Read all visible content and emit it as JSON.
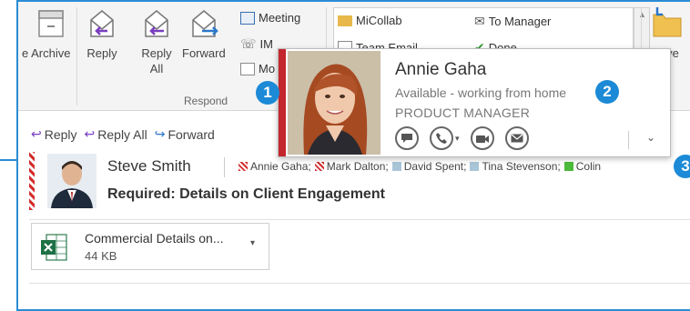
{
  "ribbon": {
    "archive_label": "e Archive",
    "reply_label": "Reply",
    "reply_all_label": "Reply All",
    "forward_label": "Forward",
    "meeting_label": "Meeting",
    "im_label": "IM",
    "more_label": "Mo",
    "respond_group": "Respond",
    "quicksteps": {
      "micollab": "MiCollab",
      "to_manager": "To Manager",
      "team_email": "Team Email",
      "done": "Done"
    },
    "move_label": "ve"
  },
  "actions": {
    "reply": "Reply",
    "reply_all": "Reply All",
    "forward": "Forward"
  },
  "message": {
    "sender": "Steve Smith",
    "subject": "Required: Details on Client Engagement",
    "recipients": [
      {
        "name": "Annie Gaha;",
        "color": "#d42e2e"
      },
      {
        "name": "Mark Dalton;",
        "color": "#d42e2e"
      },
      {
        "name": "David Spent;",
        "color": "#a9c6d8"
      },
      {
        "name": "Tina Stevenson;",
        "color": "#a9c6d8"
      },
      {
        "name": "Colin",
        "color": "#4cba3a"
      }
    ],
    "attachment": {
      "name": "Commercial Details on...",
      "size": "44 KB"
    }
  },
  "contact_card": {
    "name": "Annie Gaha",
    "status": "Available - working from home",
    "title": "PRODUCT MANAGER"
  },
  "callouts": [
    "1",
    "2",
    "3"
  ],
  "colors": {
    "accent": "#1c8ad6",
    "presence_busy": "#c4262e"
  }
}
